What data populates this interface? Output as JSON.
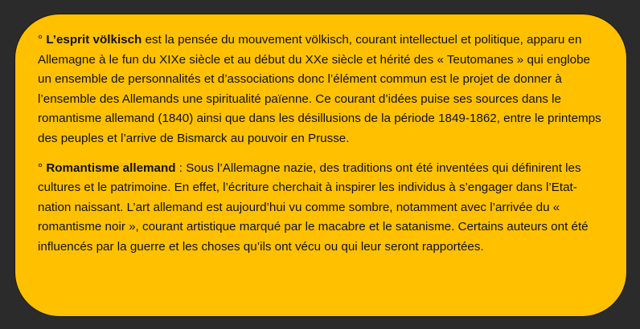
{
  "glossary": {
    "entries": [
      {
        "marker": "°",
        "term": "L’esprit völkisch",
        "text": " est la pensée du mouvement völkisch, courant intellectuel et politique, apparu en Allemagne à le fun du XIXe siècle et au début du XXe siècle et hérité des « Teutomanes » qui englobe un ensemble de personnalités et d’associations donc l’élément commun est le projet de donner à l’ensemble des Allemands une spiritualité païenne. Ce courant d’idées puise ses sources dans le romantisme allemand (1840) ainsi que dans les désillusions de la période 1849-1862, entre le printemps des peuples et l’arrive de Bismarck au pouvoir en Prusse."
      },
      {
        "marker": "°",
        "term": "Romantisme allemand",
        "text": " : Sous l’Allemagne nazie, des traditions ont été inventées qui définirent les cultures et le patrimoine. En effet, l’écriture cherchait à inspirer les individus à s’engager dans l’Etat-nation naissant. L’art allemand est aujourd’hui vu comme sombre, notamment avec l’arrivée du « romantisme noir », courant artistique marqué par le macabre et le satanisme. Certains auteurs ont été influencés par la guerre et les choses qu’ils ont vécu ou qui leur seront rapportées."
      }
    ]
  },
  "colors": {
    "background": "#2b2b2b",
    "card": "#ffc000",
    "text": "#111111"
  }
}
